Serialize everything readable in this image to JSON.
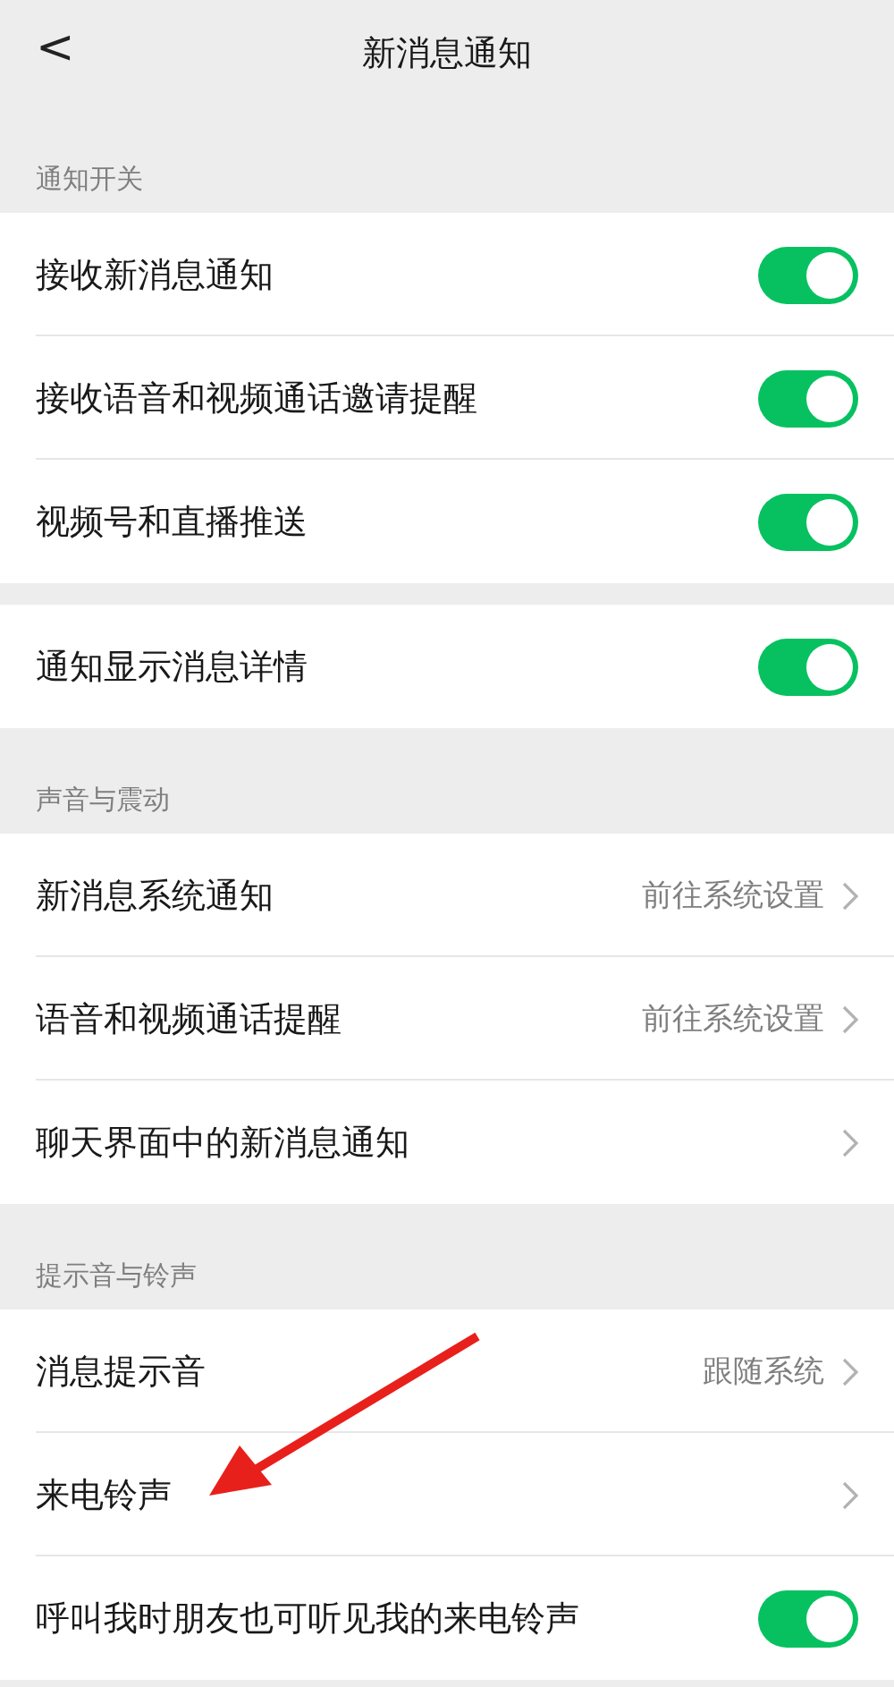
{
  "nav": {
    "back": "<",
    "title": "新消息通知"
  },
  "sections": [
    {
      "label": "通知开关",
      "rows": [
        {
          "kind": "toggle",
          "label": "接收新消息通知",
          "on": true
        },
        {
          "kind": "toggle",
          "label": "接收语音和视频通话邀请提醒",
          "on": true
        },
        {
          "kind": "toggle",
          "label": "视频号和直播推送",
          "on": true
        }
      ]
    },
    {
      "rows": [
        {
          "kind": "toggle",
          "label": "通知显示消息详情",
          "on": true
        }
      ]
    },
    {
      "label": "声音与震动",
      "rows": [
        {
          "kind": "link",
          "label": "新消息系统通知",
          "value": "前往系统设置"
        },
        {
          "kind": "link",
          "label": "语音和视频通话提醒",
          "value": "前往系统设置"
        },
        {
          "kind": "link",
          "label": "聊天界面中的新消息通知"
        }
      ]
    },
    {
      "label": "提示音与铃声",
      "rows": [
        {
          "kind": "link",
          "label": "消息提示音",
          "value": "跟随系统"
        },
        {
          "kind": "link",
          "label": "来电铃声"
        },
        {
          "kind": "toggle",
          "label": "呼叫我时朋友也可听见我的来电铃声",
          "on": true
        }
      ]
    }
  ]
}
